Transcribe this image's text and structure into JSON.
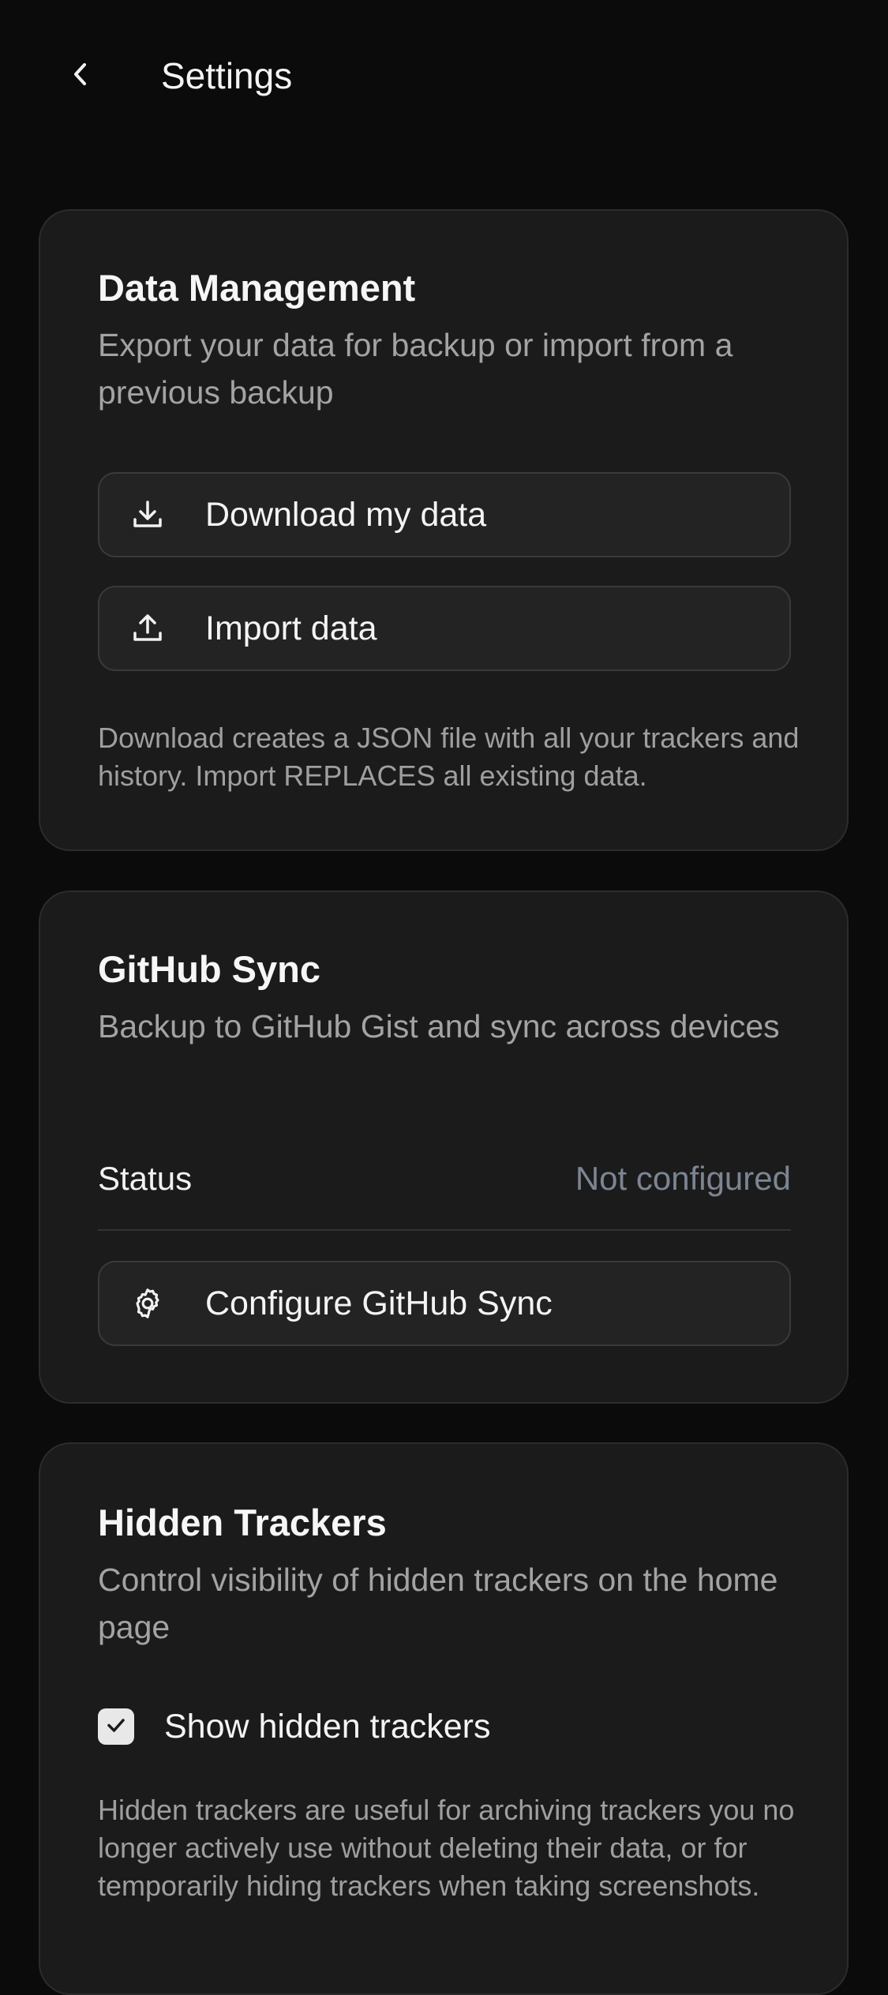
{
  "header": {
    "title": "Settings"
  },
  "data_management": {
    "title": "Data Management",
    "description": "Export your data for backup or import from a previous backup",
    "download_label": "Download my data",
    "import_label": "Import data",
    "note": "Download creates a JSON file with all your trackers and history. Import REPLACES all existing data."
  },
  "github_sync": {
    "title": "GitHub Sync",
    "description": "Backup to GitHub Gist and sync across devices",
    "status_label": "Status",
    "status_value": "Not configured",
    "configure_label": "Configure GitHub Sync"
  },
  "hidden_trackers": {
    "title": "Hidden Trackers",
    "description": "Control visibility of hidden trackers on the home page",
    "checkbox_label": "Show hidden trackers",
    "checkbox_checked": true,
    "note": "Hidden trackers are useful for archiving trackers you no longer actively use without deleting their data, or for temporarily hiding trackers when taking screenshots."
  },
  "icons": {
    "back": "chevron-left-icon",
    "download": "download-icon",
    "import": "upload-icon",
    "configure": "gear-icon",
    "checkbox": "check-icon"
  },
  "colors": {
    "background": "#0b0b0b",
    "card": "#1b1b1b",
    "button": "#232323",
    "muted_text": "#a3a3a3",
    "status_value": "#7c8593"
  }
}
